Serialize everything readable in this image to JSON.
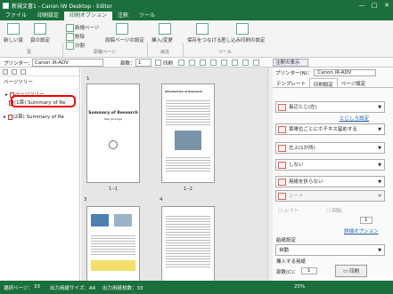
{
  "window": {
    "title": "新規文書1 - Canon iW Desktop - Editor",
    "controls": [
      "—",
      "□",
      "✕"
    ]
  },
  "menu": [
    "ファイル",
    "印刷設定",
    "印刷オプション",
    "注釈",
    "ツール"
  ],
  "ribbon": {
    "new_page": "新しい頁",
    "page_settings": "頁の設定",
    "insert_page": "新規ページ",
    "delete": "削除",
    "split": "分割",
    "import_pages": "原稿ページの設定",
    "insert_chapter": "挿入/変更",
    "combine": "保存をつなげる",
    "batch_print": "差し込み印刷の設定",
    "groups": [
      "頁",
      "原稿ページ",
      "目次",
      "ツール"
    ]
  },
  "toolbar": {
    "printer_label": "プリンター：",
    "printer": "Canon iR-ADV",
    "copies_label": "部数：",
    "copies": "1",
    "print_label": "印刷",
    "annotation_toggle": "注釈の表示"
  },
  "left": {
    "title": "ページツリー",
    "item0": "ページツリー",
    "item1": "(1章) Summary of Re",
    "item2": "(2章) Summary of Re"
  },
  "pages": [
    {
      "num": "1",
      "label": "1--1",
      "title": "Summary of Research",
      "sub": "Paul Jennings"
    },
    {
      "num": "",
      "label": "1--2",
      "title": "Introduction of Research",
      "sub": ""
    },
    {
      "num": "3",
      "label": "",
      "title": "",
      "sub": ""
    },
    {
      "num": "4",
      "label": "",
      "title": "",
      "sub": ""
    }
  ],
  "right": {
    "printer_label": "プリンター(N)：",
    "printer": "Canon iR-ADV",
    "tabs": [
      "テンプレート",
      "印刷設定",
      "ページ設定"
    ],
    "duplex": "長辺とじ(左)",
    "more_link": "とじしろ設定",
    "finishing": "章単位ごとにホチキス留めする",
    "staple": "左上(1か所)",
    "punch": "しない",
    "fold": "用紙を折らない",
    "sheet": "シート",
    "shift": "シフト",
    "rotate": "回転",
    "count": "1",
    "detail_link": "詳細オプション",
    "paper_source_label": "給紙設定",
    "paper_source": "自動",
    "insert_label": "挿入する用紙",
    "copies_label": "部数(C)：",
    "copies": "1",
    "print_button": "印刷"
  },
  "status": {
    "left": "選択ページ：",
    "pages": "33",
    "size_label": "出力用紙サイズ：A4",
    "total_label": "出力用紙枚数：33",
    "zoom": "25%"
  }
}
